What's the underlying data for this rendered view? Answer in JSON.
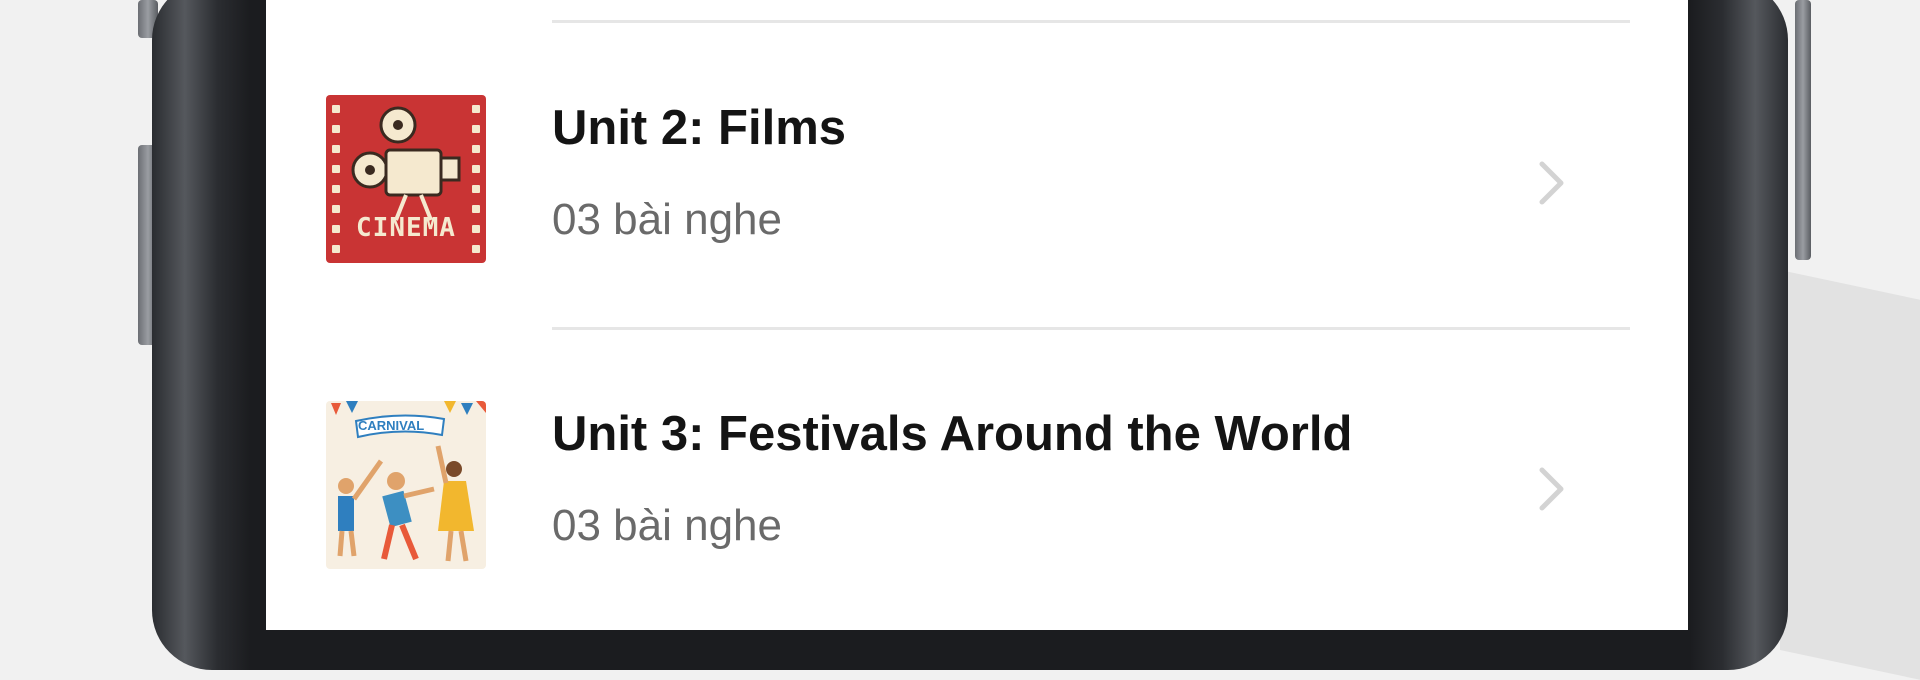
{
  "units": [
    {
      "title": "Unit 2: Films",
      "subtitle": "03 bài nghe",
      "thumb_text": "CINEMA",
      "thumb_color": "#c93434"
    },
    {
      "title": "Unit 3: Festivals Around the World",
      "subtitle": "03 bài nghe",
      "thumb_text": "CARNIVAL",
      "thumb_color": "#f7efe2"
    }
  ],
  "colors": {
    "title": "#141414",
    "subtitle": "#6a6a6a",
    "divider": "#e6e6e6",
    "chevron": "#d3d3d3"
  }
}
